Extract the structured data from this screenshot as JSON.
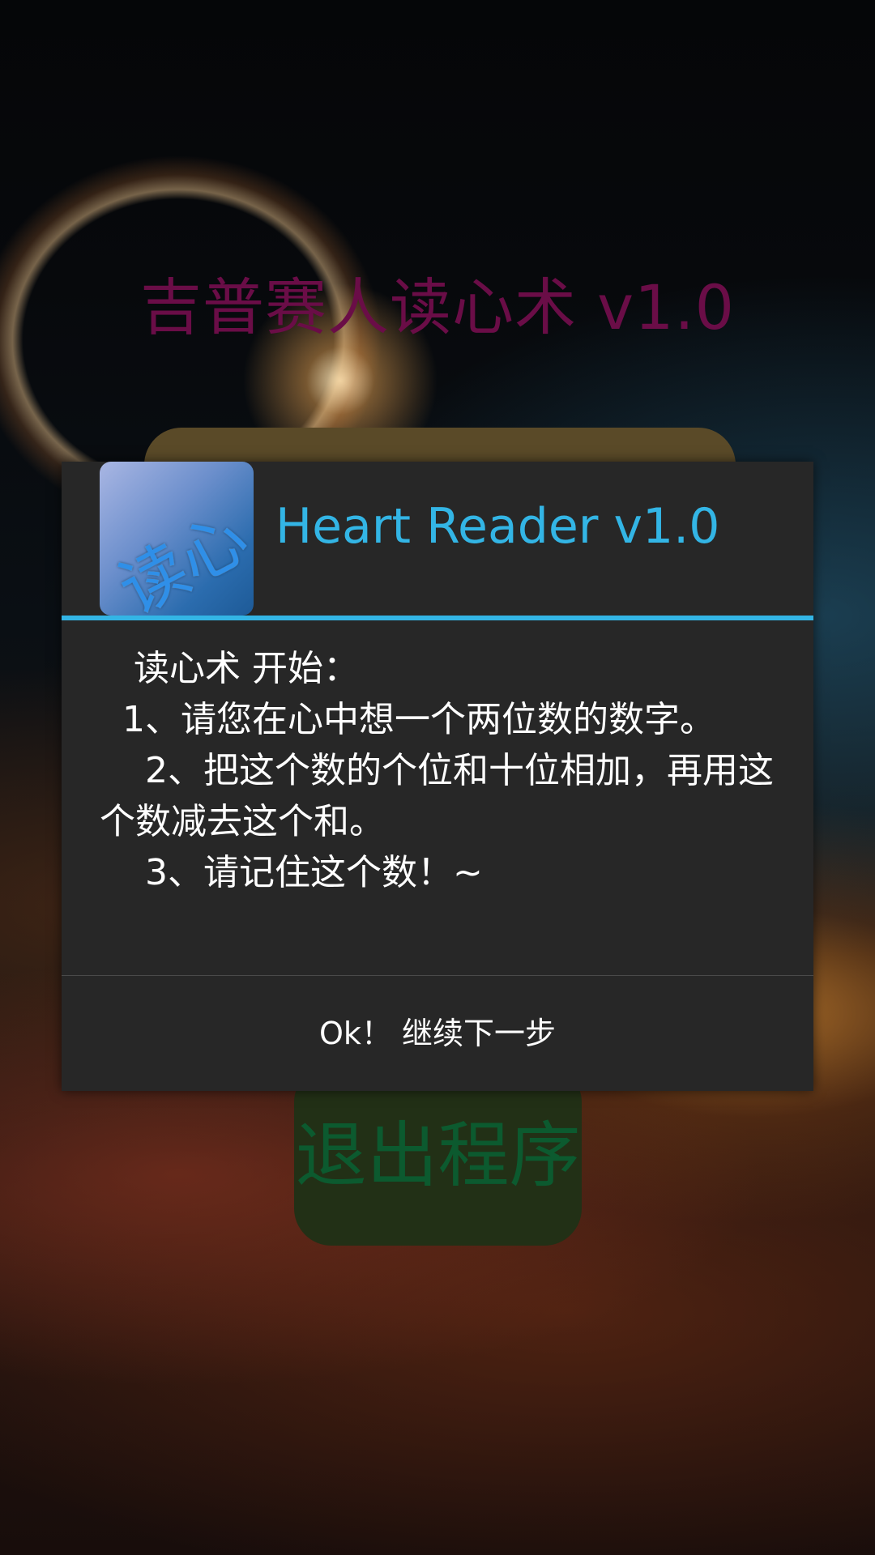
{
  "app": {
    "title": "吉普赛人读心术 v1.0",
    "exit_label": "退出程序"
  },
  "dialog": {
    "icon_label": "读心",
    "title": "Heart Reader v1.0",
    "message": "   读心术 开始：\n  1、请您在心中想一个两位数的数字。\n    2、把这个数的个位和十位相加，再用这个数减去这个和。\n    3、请记住这个数！~",
    "ok_label": "Ok！ 继续下一步"
  },
  "colors": {
    "app_title": "#6a0d47",
    "dialog_accent": "#33b5e5",
    "dialog_background": "#272727",
    "exit_text": "#0c5a2f"
  }
}
